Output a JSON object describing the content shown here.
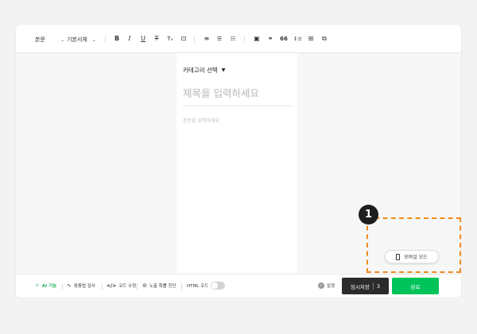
{
  "toolbar": {
    "paragraph_style": "본문",
    "font_family": "기본서체",
    "format_icons": {
      "bold": "B",
      "italic": "I",
      "underline": "U",
      "strike": "T",
      "subscript": "Tₓ",
      "text_box": "⊡",
      "align": "≡",
      "bullet_list": "☰",
      "numbered_list": "☷",
      "image": "▣",
      "link": "⚭",
      "quote": "66",
      "line_spacing": "↕≡",
      "table": "⊞",
      "special": "⧉"
    }
  },
  "editor": {
    "category_label": "카테고리 선택",
    "title_placeholder": "제목을 입력하세요",
    "body_placeholder": "본문을 입력하세요"
  },
  "bottombar": {
    "ai_label": "AI 기능",
    "spellcheck_label": "맞춤법 검사",
    "code_label": "코드 수정",
    "exposure_label": "노출 확률 진단",
    "html_label": "HTML 코드",
    "publish_label": "발행",
    "save_label": "임시저장",
    "save_count": "3",
    "done_label": "완료"
  },
  "mobile_mode_label": "모바일 모드",
  "step_number": "1",
  "colors": {
    "accent_green": "#00c459",
    "highlight_orange": "#f08a1c",
    "dark_button": "#2b2b2b"
  }
}
